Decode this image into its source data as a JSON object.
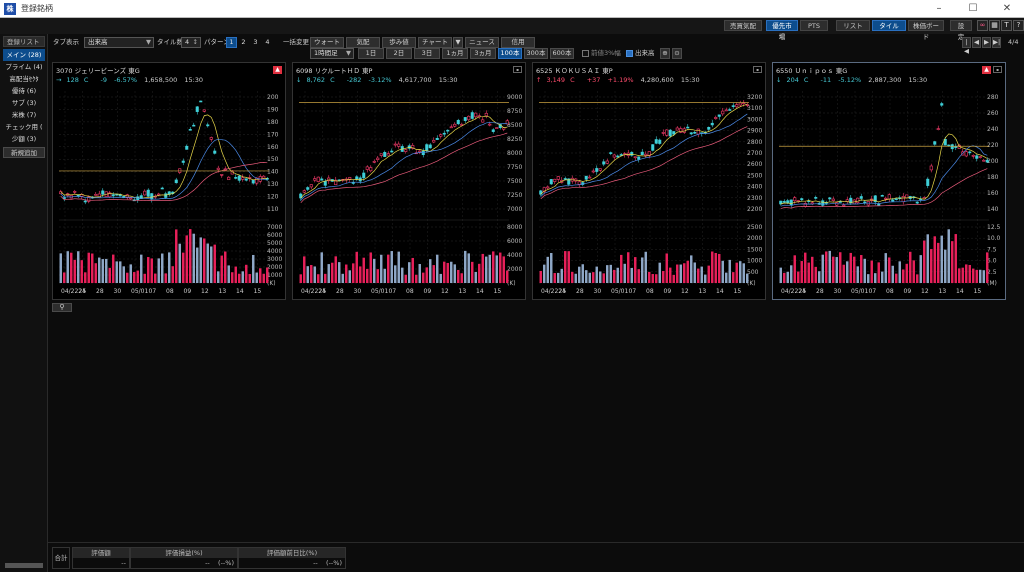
{
  "window": {
    "title": "登録銘柄",
    "app_icon": "株"
  },
  "topbar": {
    "buttons": [
      "売買気配",
      "優先市場",
      "PTS",
      "リスト",
      "タイル",
      "株価ボード",
      "設定"
    ],
    "active": [
      "優先市場",
      "タイル"
    ]
  },
  "sidebar": {
    "header": "登録リスト",
    "items": [
      "メイン (28)",
      "プライム (4)",
      "高配当ｾｸﾀ",
      "優待 (6)",
      "サブ (3)",
      "米株 (7)",
      "チェック用 (",
      "少額 (3)"
    ],
    "add_label": "新規追加"
  },
  "toolbar": {
    "tab_display_label": "タブ表示",
    "sort_value": "出来高",
    "tile_count_label": "タイル数",
    "tile_count": "4",
    "pattern_label": "パターン",
    "patterns": [
      "1",
      "2",
      "3",
      "4"
    ],
    "bulk_change_label": "一括変更",
    "view_buttons": [
      "ウォート",
      "気配",
      "歩み値",
      "チャート",
      "ニュース",
      "信用"
    ],
    "interval_value": "1時間足",
    "periods": [
      "1日",
      "2日",
      "3日",
      "1ヵ月",
      "3ヵ月",
      "100本",
      "300本",
      "600本"
    ],
    "active_period": "100本",
    "limit_label": "前値3%幅",
    "volume_label": "出来高",
    "nav": [
      "|◀",
      "◀",
      "▶",
      "▶|"
    ],
    "page": "4/4"
  },
  "tiles": [
    {
      "code": "3070",
      "name": "ジェリービーンズ",
      "market": "東G",
      "price": "128",
      "price_suffix": "C",
      "change": "-9",
      "change_pct": "-6.57%",
      "volume": "1,658,500",
      "time": "15:30",
      "direction": "down",
      "alert": true,
      "price_ticks": [
        "200",
        "190",
        "180",
        "170",
        "160",
        "150",
        "140",
        "130",
        "120",
        "110"
      ],
      "volume_ticks": [
        "7000",
        "6000",
        "5000",
        "4000",
        "3000",
        "2000",
        "1000",
        "(K)"
      ],
      "x_ticks": [
        "04/2224",
        "25",
        "28",
        "30",
        "05/01",
        "07",
        "08",
        "09",
        "12",
        "13",
        "14",
        "15"
      ]
    },
    {
      "code": "6098",
      "name": "リクルートＨＤ",
      "market": "東P",
      "price": "8,762",
      "price_suffix": "C",
      "change": "-282",
      "change_pct": "-3.12%",
      "volume": "4,617,700",
      "time": "15:30",
      "direction": "down",
      "alert": false,
      "price_ticks": [
        "9000",
        "8750",
        "8500",
        "8250",
        "8000",
        "7750",
        "7500",
        "7250",
        "7000"
      ],
      "volume_ticks": [
        "8000",
        "6000",
        "4000",
        "2000",
        "(K)"
      ],
      "x_ticks": [
        "04/2224",
        "25",
        "28",
        "30",
        "05/01",
        "07",
        "08",
        "09",
        "12",
        "13",
        "14",
        "15"
      ]
    },
    {
      "code": "6525",
      "name": "ＫＯＫＵＳＡＩ",
      "market": "東P",
      "price": "3,149",
      "price_suffix": "C",
      "change": "+37",
      "change_pct": "+1.19%",
      "volume": "4,280,600",
      "time": "15:30",
      "direction": "up",
      "alert": false,
      "price_ticks": [
        "3200",
        "3100",
        "3000",
        "2900",
        "2800",
        "2700",
        "2600",
        "2500",
        "2400",
        "2300",
        "2200"
      ],
      "volume_ticks": [
        "2500",
        "2000",
        "1500",
        "1000",
        "500",
        "(K)"
      ],
      "x_ticks": [
        "04/2224",
        "25",
        "28",
        "30",
        "05/01",
        "07",
        "08",
        "09",
        "12",
        "13",
        "14",
        "15"
      ]
    },
    {
      "code": "6550",
      "name": "Ｕｎｉｐｏｓ",
      "market": "東G",
      "price": "204",
      "price_suffix": "C",
      "change": "-11",
      "change_pct": "-5.12%",
      "volume": "2,887,300",
      "time": "15:30",
      "direction": "down",
      "alert": true,
      "price_ticks": [
        "280",
        "260",
        "240",
        "220",
        "200",
        "180",
        "160",
        "140"
      ],
      "volume_ticks": [
        "12.5",
        "10.0",
        "7.5",
        "5.0",
        "2.5",
        "(M)"
      ],
      "x_ticks": [
        "04/2224",
        "25",
        "28",
        "30",
        "05/01",
        "07",
        "08",
        "09",
        "12",
        "13",
        "14",
        "15"
      ]
    }
  ],
  "summary": {
    "total_label": "合計",
    "headers": [
      "評価額",
      "評価損益(%)",
      "評価額前日比(%)"
    ],
    "values": [
      "--",
      "--",
      "(--%)",
      "--",
      "(--%)"
    ]
  },
  "colors": {
    "up": "#ff4d6d",
    "down": "#46c7d2",
    "accent": "#0d4d8d",
    "alert": "#e03040"
  }
}
